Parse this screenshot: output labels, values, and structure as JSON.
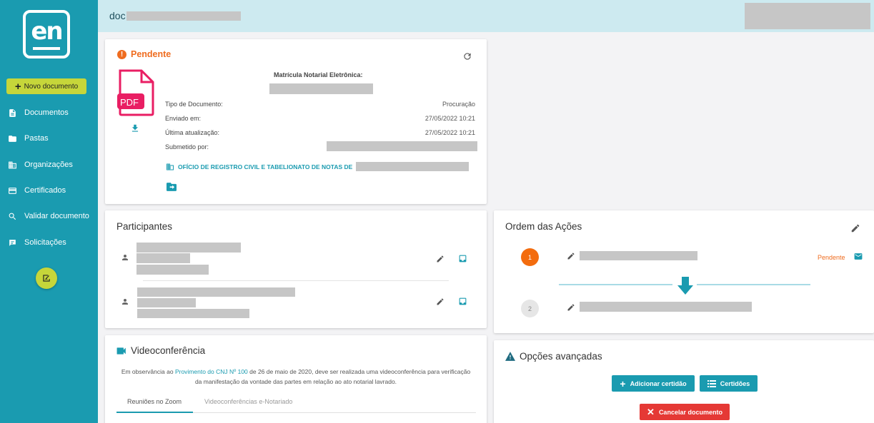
{
  "app": {
    "logo_text": "en",
    "doc_title_prefix": "doc"
  },
  "sidebar": {
    "new_document_label": "Novo documento",
    "items": [
      {
        "label": "Documentos",
        "icon": "document-icon"
      },
      {
        "label": "Pastas",
        "icon": "folder-icon"
      },
      {
        "label": "Organizações",
        "icon": "building-icon"
      },
      {
        "label": "Certificados",
        "icon": "card-icon"
      },
      {
        "label": "Validar documento",
        "icon": "search-icon"
      },
      {
        "label": "Solicitações",
        "icon": "request-icon"
      }
    ]
  },
  "status": {
    "title": "Pendente",
    "pdf_label": "PDF",
    "matricula_label": "Matrícula Notarial Eletrônica:",
    "tipo_label": "Tipo de Documento:",
    "tipo_value": "Procuração",
    "enviado_label": "Enviado em:",
    "enviado_value": "27/05/2022 10:21",
    "ultima_label": "Última atualização:",
    "ultima_value": "27/05/2022 10:21",
    "submetido_label": "Submetido por:",
    "office_label": "OFÍCIO DE REGISTRO CIVIL E TABELIONATO DE NOTAS DE"
  },
  "participants": {
    "title": "Participantes"
  },
  "order": {
    "title": "Ordem das Ações",
    "steps": [
      {
        "number": "1",
        "status": "Pendente"
      },
      {
        "number": "2",
        "status": ""
      }
    ]
  },
  "video": {
    "title": "Videoconferência",
    "text_before": "Em observância ao ",
    "link": "Provimento do CNJ Nº 100",
    "text_after": " de 26 de maio de 2020, deve ser realizada uma videoconferência para verificação da manifestação da vontade das partes em relação ao ato notarial lavrado.",
    "tabs": [
      "Reuniões no Zoom",
      "Videoconferências e-Notariado"
    ]
  },
  "options": {
    "title": "Opções avançadas",
    "add_cert_label": "Adicionar certidão",
    "certs_label": "Certidões",
    "cancel_label": "Cancelar documento"
  },
  "colors": {
    "sidebar": "#1a9bb0",
    "accent": "#1a9bb0",
    "pending": "#ef6c1f",
    "new_doc_button": "#c6d63a",
    "danger": "#e53935",
    "pdf": "#e91e63"
  }
}
